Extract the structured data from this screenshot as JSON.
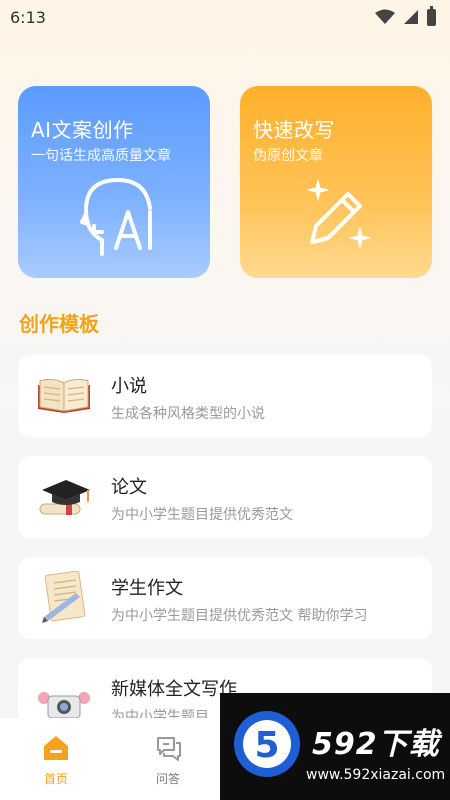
{
  "status_bar": {
    "time": "6:13"
  },
  "feature_cards": [
    {
      "title": "AI文案创作",
      "subtitle": "一句话生成高质量文章",
      "icon": "ai-head-icon",
      "color": "#5a9bff"
    },
    {
      "title": "快速改写",
      "subtitle": "伪原创文章",
      "icon": "magic-pen-icon",
      "color": "#ffb02a"
    }
  ],
  "section": {
    "title": "创作模板"
  },
  "templates": [
    {
      "title": "小说",
      "description": "生成各种风格类型的小说",
      "icon": "open-book-icon"
    },
    {
      "title": "论文",
      "description": "为中小学生题目提供优秀范文",
      "icon": "graduation-cap-icon"
    },
    {
      "title": "学生作文",
      "description": "为中小学生题目提供优秀范文 帮助你学习",
      "icon": "paper-pencil-icon"
    },
    {
      "title": "新媒体全文写作",
      "description": "为中小学生题目",
      "icon": "camera-icon"
    }
  ],
  "tab_bar": {
    "home": "首页",
    "qa": "问答",
    "active_color": "#f3a21c"
  },
  "watermark": {
    "brand": "592下载",
    "url": "www.592xiazai.com",
    "logo_char": "5"
  }
}
